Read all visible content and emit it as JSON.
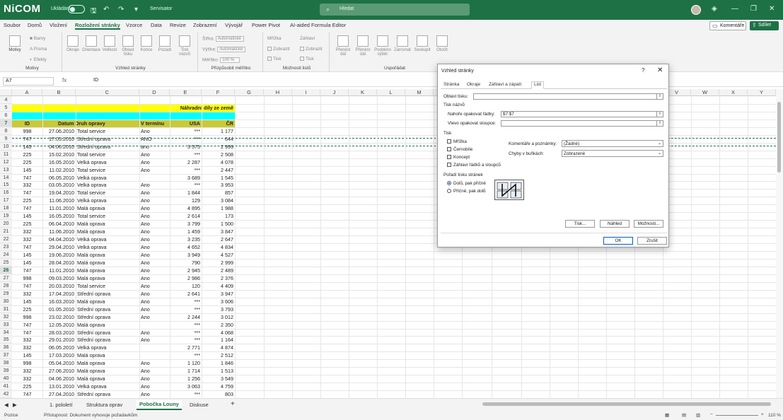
{
  "titlebar": {
    "logo": "NiCOM",
    "autosave_label": "Ukládání",
    "doc_name": "Servisator",
    "search_placeholder": "Hledat"
  },
  "menu": [
    "Soubor",
    "Domů",
    "Vložení",
    "Rozložení stránky",
    "Vzorce",
    "Data",
    "Revize",
    "Zobrazení",
    "Vývojář",
    "Power Pivot",
    "AI-aided Formula Editor"
  ],
  "menu_active": "Rozložení stránky",
  "comments_label": "Komentáře",
  "share_label": "Sdílet",
  "ribbon": {
    "groups": {
      "motivy": "Motivy",
      "vzhled": "Vzhled stránky",
      "prizpusobit": "Přizpůsobit měřítko",
      "moznosti": "Možnosti listů",
      "uspora": "Uspořádat"
    },
    "motivy_btn": "Motivy",
    "barvy": "Barvy",
    "pisma": "Písma",
    "efekty": "Efekty",
    "vzhled_btns": [
      "Okraje",
      "Orientace",
      "Velikost",
      "Oblast tisku",
      "Konce",
      "Pozadí",
      "Tisk názvů"
    ],
    "sirka": "Šířka:",
    "vyska": "Výška:",
    "meritko": "Měřítko:",
    "auto": "Automatické",
    "zoom": "100 %",
    "mrizka": "Mřížka",
    "zahlavi": "Záhlaví",
    "zobrazit": "Zobrazit",
    "tisk": "Tisk",
    "uspora_btns": [
      "Přenést dál",
      "Přenést dál",
      "Podokno výběr",
      "Zarovnat",
      "Seskupit",
      "Otočit"
    ]
  },
  "formula_bar": {
    "name": "A7",
    "fx": "fx",
    "value": "ID"
  },
  "columns": [
    "A",
    "B",
    "C",
    "D",
    "E",
    "F",
    "G",
    "H",
    "I",
    "J",
    "K",
    "L",
    "M",
    "N",
    "O",
    "P",
    "Q",
    "R",
    "S",
    "T",
    "U",
    "V",
    "W",
    "X",
    "Y"
  ],
  "title_cell": "Náhradní díly ze země",
  "headers": [
    "ID",
    "Datum",
    "Druh opravy",
    "V termínu",
    "USA",
    "ČR"
  ],
  "rows": [
    [
      "8",
      "998",
      "27.06.2010",
      "Total service",
      "Ano",
      "***",
      "1 177"
    ],
    [
      "9",
      "747",
      "17.05.2010",
      "Střední oprava",
      "ANO",
      "***",
      "644"
    ],
    [
      "10",
      "145",
      "04.06.2010",
      "Střední oprava",
      "ano",
      "3 575",
      "2 999"
    ],
    [
      "11",
      "225",
      "15.02.2010",
      "Total service",
      "Ano",
      "***",
      "2 508"
    ],
    [
      "12",
      "225",
      "16.05.2010",
      "Velká oprava",
      "Ano",
      "2 287",
      "4 078"
    ],
    [
      "13",
      "145",
      "11.02.2010",
      "Total service",
      "Ano",
      "***",
      "2 447"
    ],
    [
      "14",
      "747",
      "06.05.2010",
      "Velká oprava",
      "",
      "3 689",
      "1 545"
    ],
    [
      "15",
      "332",
      "03.05.2010",
      "Velká oprava",
      "Ano",
      "***",
      "3 953"
    ],
    [
      "16",
      "747",
      "19.04.2010",
      "Total service",
      "Ano",
      "1 844",
      "857"
    ],
    [
      "17",
      "225",
      "11.06.2010",
      "Velká oprava",
      "Ano",
      "129",
      "3 084"
    ],
    [
      "18",
      "747",
      "11.01.2010",
      "Malá oprava",
      "Ano",
      "4 895",
      "1 988"
    ],
    [
      "19",
      "145",
      "16.05.2010",
      "Total service",
      "Ano",
      "2 614",
      "173"
    ],
    [
      "20",
      "225",
      "06.04.2010",
      "Malá oprava",
      "Ano",
      "3 799",
      "1 500"
    ],
    [
      "21",
      "332",
      "11.06.2010",
      "Malá oprava",
      "Ano",
      "1 459",
      "3 847"
    ],
    [
      "22",
      "332",
      "04.04.2010",
      "Velká oprava",
      "Ano",
      "3 235",
      "2 647"
    ],
    [
      "23",
      "747",
      "29.04.2010",
      "Velká oprava",
      "Ano",
      "4 652",
      "4 834"
    ],
    [
      "24",
      "145",
      "19.06.2010",
      "Malá oprava",
      "Ano",
      "3 949",
      "4 527"
    ],
    [
      "25",
      "145",
      "28.04.2010",
      "Malá oprava",
      "Ano",
      "790",
      "2 999"
    ],
    [
      "26",
      "747",
      "11.01.2010",
      "Malá oprava",
      "Ano",
      "2 945",
      "2 489"
    ],
    [
      "27",
      "998",
      "09.03.2010",
      "Malá oprava",
      "Ano",
      "2 986",
      "2 376"
    ],
    [
      "28",
      "747",
      "20.03.2010",
      "Total service",
      "Ano",
      "120",
      "4 409"
    ],
    [
      "29",
      "332",
      "17.04.2010",
      "Střední oprava",
      "Ano",
      "2 641",
      "3 947"
    ],
    [
      "30",
      "145",
      "16.03.2010",
      "Malá oprava",
      "Ano",
      "***",
      "3 606"
    ],
    [
      "31",
      "225",
      "01.05.2010",
      "Střední oprava",
      "Ano",
      "***",
      "3 793"
    ],
    [
      "32",
      "998",
      "23.02.2010",
      "Střední oprava",
      "Ano",
      "2 244",
      "3 012"
    ],
    [
      "33",
      "747",
      "12.05.2010",
      "Malá oprava",
      "",
      "***",
      "2 350"
    ],
    [
      "34",
      "747",
      "28.03.2010",
      "Střední oprava",
      "Ano",
      "***",
      "4 068"
    ],
    [
      "35",
      "332",
      "29.01.2010",
      "Střední oprava",
      "Ano",
      "***",
      "1 164"
    ],
    [
      "36",
      "332",
      "06.05.2010",
      "Velká oprava",
      "",
      "2 771",
      "4 874"
    ],
    [
      "37",
      "145",
      "17.03.2010",
      "Malá oprava",
      "",
      "***",
      "2 512"
    ],
    [
      "38",
      "998",
      "05.04.2010",
      "Malá oprava",
      "Ano",
      "1 120",
      "1 846"
    ],
    [
      "39",
      "332",
      "27.06.2010",
      "Malá oprava",
      "Ano",
      "1 714",
      "1 513"
    ],
    [
      "40",
      "332",
      "04.06.2010",
      "Malá oprava",
      "Ano",
      "1 256",
      "3 549"
    ],
    [
      "41",
      "225",
      "13.01.2010",
      "Velká oprava",
      "Ano",
      "3 063",
      "4 759"
    ],
    [
      "42",
      "747",
      "27.04.2010",
      "Střední oprava",
      "Ano",
      "***",
      "803"
    ]
  ],
  "sheet_tabs": [
    "1. pololetí",
    "Struktura oprav",
    "Pobočka Louny",
    "Diskuse"
  ],
  "sheet_active": "Pobočka Louny",
  "status": {
    "mode": "Pozice",
    "accessibility": "Přístupnost: Dokument vyhovuje požadavkům",
    "zoom": "110 %"
  },
  "dialog": {
    "title": "Vzhled stránky",
    "help": "?",
    "tabs": [
      "Stránka",
      "Okraje",
      "Záhlaví a zápatí",
      "List"
    ],
    "active_tab": "List",
    "oblast_label": "Oblast tisku:",
    "tisk_nazvu": "Tisk názvů",
    "nahore_label": "Nahoře opakovat řádky:",
    "nahore_value": "$7:$7",
    "vlevo_label": "Vlevo opakovat sloupce:",
    "tisk": "Tisk",
    "mrizka": "Mřížka",
    "cernobile": "Černobíle",
    "koncept": "Koncept",
    "zahlavi": "Záhlaví řádků a sloupců",
    "komentare_label": "Komentáře a poznámky:",
    "komentare_value": "(Žádné)",
    "chyby_label": "Chyby v buňkách:",
    "chyby_value": "Zobrazené",
    "poradi": "Pořadí tisku stránek",
    "dolu": "Dolů, pak příčně",
    "pricne": "Příčně, pak dolů",
    "btn_tisk": "Tisk...",
    "btn_nahled": "Náhled",
    "btn_moznosti": "Možnosti...",
    "btn_ok": "OK",
    "btn_zrusit": "Zrušit"
  },
  "colors": {
    "green": "#1e7145",
    "yellow": "#ffff00",
    "cyan": "#00ffff",
    "olive": "#c9c93a"
  }
}
